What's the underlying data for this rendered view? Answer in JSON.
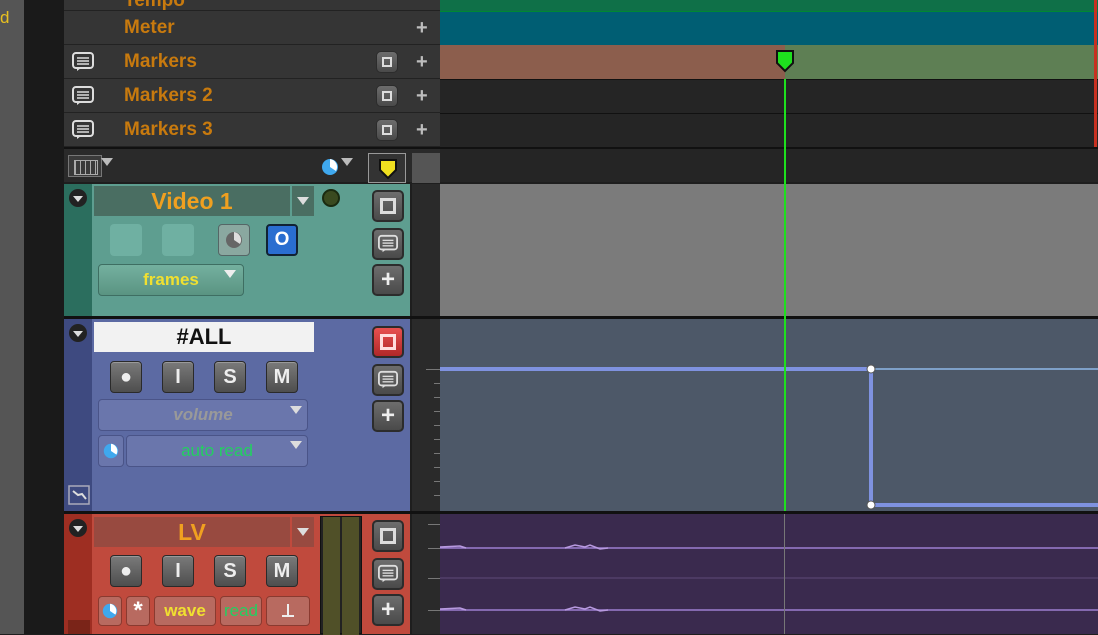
{
  "ruler_rows": [
    {
      "label": "Tempo",
      "has_note_icon": false,
      "has_lock_btn": false
    },
    {
      "label": "Meter",
      "has_note_icon": false,
      "has_lock_btn": false
    },
    {
      "label": "Markers",
      "has_note_icon": true,
      "has_lock_btn": true
    },
    {
      "label": "Markers 2",
      "has_note_icon": true,
      "has_lock_btn": true
    },
    {
      "label": "Markers 3",
      "has_note_icon": true,
      "has_lock_btn": true
    }
  ],
  "left_edge_text": "d",
  "tracks": {
    "video": {
      "name": "Video 1",
      "toggle_label": "O",
      "timebase": "frames"
    },
    "bus": {
      "name": "#ALL",
      "rec": "●",
      "input": "I",
      "solo": "S",
      "mute": "M",
      "view": "volume",
      "automation": "auto read"
    },
    "audio": {
      "name": "LV",
      "rec": "●",
      "input": "I",
      "solo": "S",
      "mute": "M",
      "view": "wave",
      "automation": "read",
      "asterisk": "*"
    }
  },
  "colors": {
    "tempo_lane": "#0f7048",
    "meter_lane": "#005e73",
    "markers_lane_left": "#8c5e4d",
    "markers_lane_right": "#5e7f54",
    "playhead": "#1ee01e",
    "video_track": "#5e9e90",
    "bus_track": "#5c6aa3",
    "audio_track": "#c04a3d",
    "track_name": "#f0a020",
    "automation_line": "#7f92e0"
  }
}
